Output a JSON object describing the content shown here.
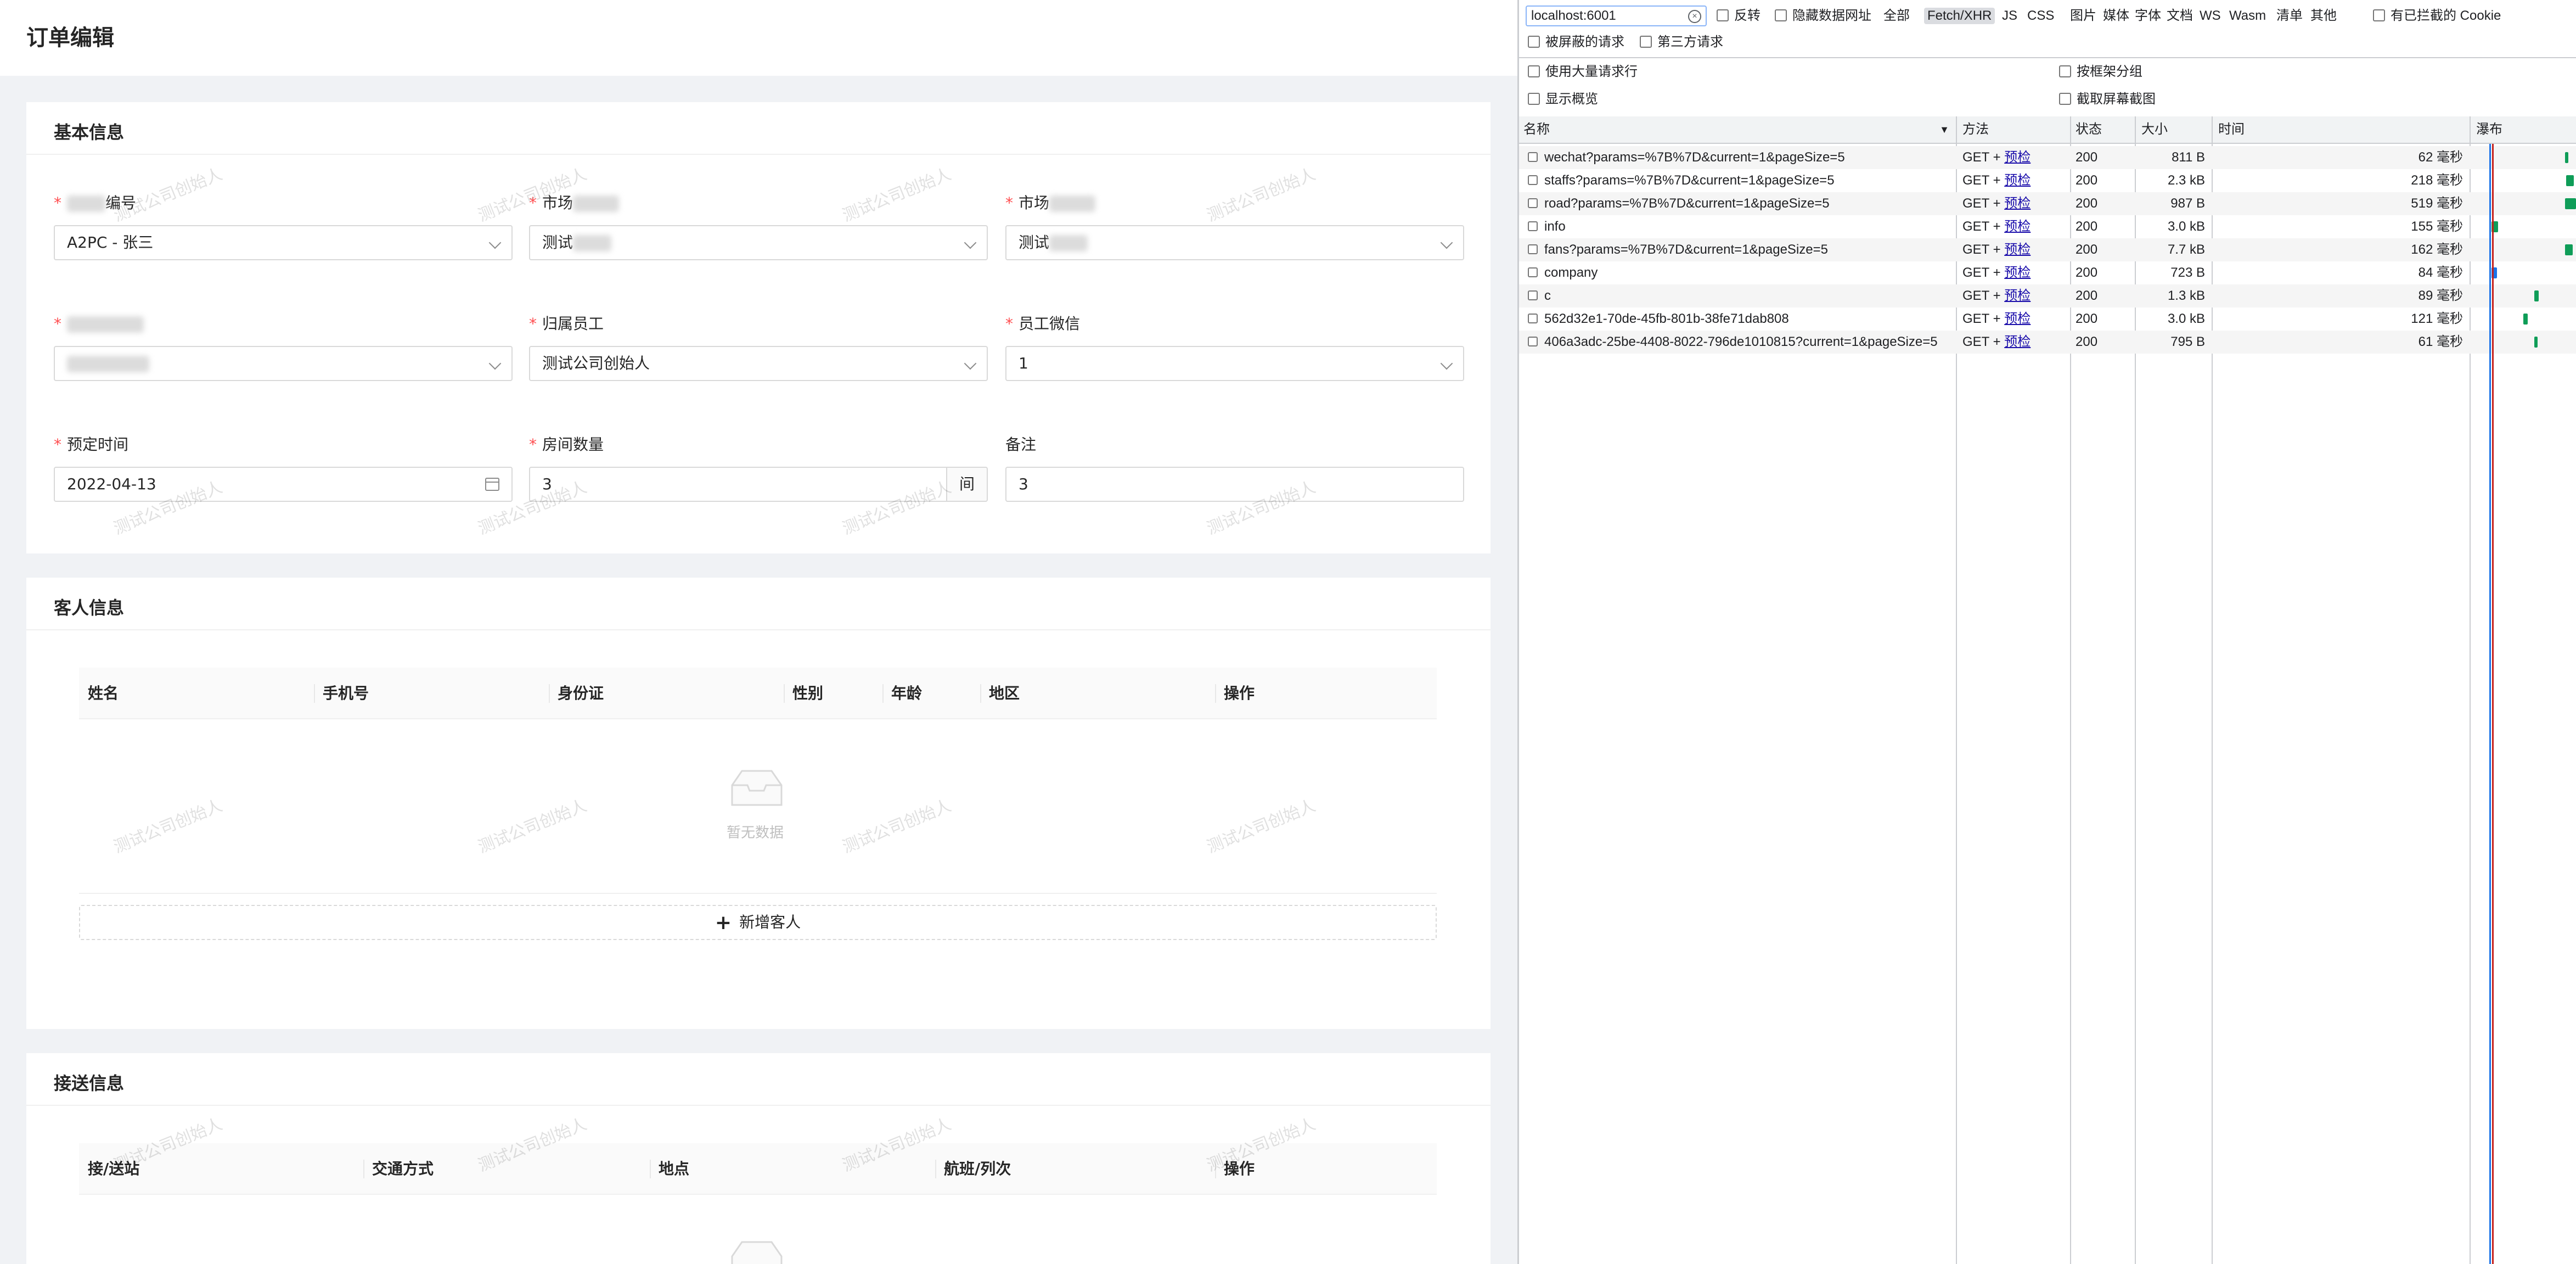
{
  "app": {
    "page_title": "订单编辑",
    "watermark": "测试公司创始人",
    "basic": {
      "title": "基本信息",
      "fields": {
        "order_no": {
          "label_tail": "编号",
          "value": "A2PC - 张三"
        },
        "market1": {
          "label": "市场",
          "value": "测试"
        },
        "market2": {
          "label": "市场",
          "value": "测试"
        },
        "staff": {
          "label": "归属员工",
          "value": "测试公司创始人"
        },
        "wechat": {
          "label": "员工微信",
          "value": "1"
        },
        "date": {
          "label": "预定时间",
          "value": "2022-04-13"
        },
        "rooms": {
          "label": "房间数量",
          "value": "3",
          "unit": "间"
        },
        "remark": {
          "label": "备注",
          "value": "3"
        }
      }
    },
    "guests": {
      "title": "客人信息",
      "columns": [
        "姓名",
        "手机号",
        "身份证",
        "性别",
        "年龄",
        "地区",
        "操作"
      ],
      "empty_text": "暂无数据",
      "add_label": "新增客人"
    },
    "transfer": {
      "title": "接送信息",
      "columns": [
        "接/送站",
        "交通方式",
        "地点",
        "航班/列次",
        "操作"
      ]
    }
  },
  "devtools": {
    "filter_value": "localhost:6001",
    "toolbar": {
      "invert": "反转",
      "hide_data_urls": "隐藏数据网址",
      "all": "全部",
      "types": [
        "Fetch/XHR",
        "JS",
        "CSS",
        "图片",
        "媒体",
        "字体",
        "文档",
        "WS",
        "Wasm",
        "清单",
        "其他"
      ],
      "blocked_cookies": "有已拦截的 Cookie",
      "blocked_requests": "被屏蔽的请求",
      "third_party": "第三方请求",
      "large_rows": "使用大量请求行",
      "group_by_frame": "按框架分组",
      "overview": "显示概览",
      "screenshots": "截取屏幕截图"
    },
    "columns": {
      "name": "名称",
      "method": "方法",
      "status": "状态",
      "size": "大小",
      "time": "时间",
      "waterfall": "瀑布"
    },
    "preflight_label": "预检",
    "requests": [
      {
        "name": "wechat?params=%7B%7D&current=1&pageSize=5",
        "method": "GET +",
        "status": "200",
        "size": "811 B",
        "time": "62 毫秒"
      },
      {
        "name": "staffs?params=%7B%7D&current=1&pageSize=5",
        "method": "GET +",
        "status": "200",
        "size": "2.3 kB",
        "time": "218 毫秒"
      },
      {
        "name": "road?params=%7B%7D&current=1&pageSize=5",
        "method": "GET +",
        "status": "200",
        "size": "987 B",
        "time": "519 毫秒"
      },
      {
        "name": "info",
        "method": "GET +",
        "status": "200",
        "size": "3.0 kB",
        "time": "155 毫秒"
      },
      {
        "name": "fans?params=%7B%7D&current=1&pageSize=5",
        "method": "GET +",
        "status": "200",
        "size": "7.7 kB",
        "time": "162 毫秒"
      },
      {
        "name": "company",
        "method": "GET +",
        "status": "200",
        "size": "723 B",
        "time": "84 毫秒"
      },
      {
        "name": "c",
        "method": "GET +",
        "status": "200",
        "size": "1.3 kB",
        "time": "89 毫秒"
      },
      {
        "name": "562d32e1-70de-45fb-801b-38fe71dab808",
        "method": "GET +",
        "status": "200",
        "size": "3.0 kB",
        "time": "121 毫秒"
      },
      {
        "name": "406a3adc-25be-4408-8022-796de1010815?current=1&pageSize=5",
        "method": "GET +",
        "status": "200",
        "size": "795 B",
        "time": "61 毫秒"
      }
    ],
    "colors": {
      "waterfall_green": "#0f9d58",
      "waterfall_blue": "#1a73e8",
      "dom_line": "#1a73e8",
      "load_line": "#c5221f"
    }
  }
}
